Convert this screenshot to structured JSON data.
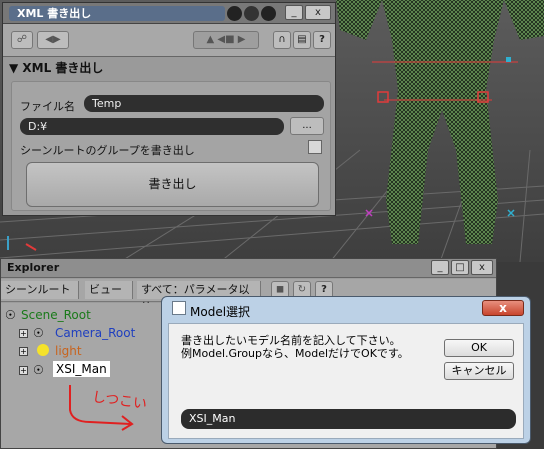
{
  "xml_dialog": {
    "title": "XML 書き出し",
    "title_buttons": [
      "?",
      "_",
      "x"
    ],
    "section": "XML 書き出し",
    "filename_label": "ファイル名",
    "filename_value": "Temp",
    "path_value": "D:¥",
    "browse_label": "...",
    "scene_root_group_label": "シーンルートのグループを書き出し",
    "export_button": "書き出し"
  },
  "explorer": {
    "title": "Explorer",
    "menu": [
      "シーンルート(S)",
      "ビュー",
      "すべて：パラメータ以外(E)"
    ],
    "toolbar_icons": [
      "lock-icon",
      "refresh-icon",
      "help-icon"
    ],
    "tree": [
      {
        "label": "Scene_Root",
        "color": "#1a7a1a"
      },
      {
        "label": "Camera_Root",
        "color": "#1f3fbf"
      },
      {
        "label": "light",
        "color": "#c8641e"
      },
      {
        "label": "XSI_Man",
        "color": "#000000"
      }
    ]
  },
  "model_dialog": {
    "title": "Model選択",
    "close_label": "x",
    "message": "書き出したいモデル名前を記入して下さい。\n例Model.Groupなら、ModelだけでOKです。",
    "ok_label": "OK",
    "cancel_label": "キャンセル",
    "input_value": "XSI_Man"
  },
  "annotation": {
    "text": "しつこい",
    "color": "#e02020"
  }
}
